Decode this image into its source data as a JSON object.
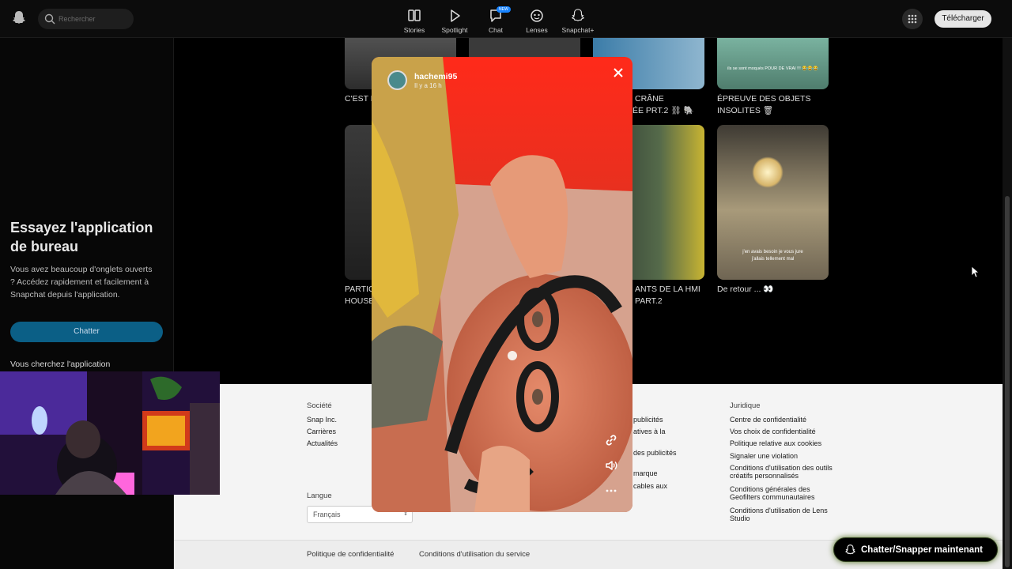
{
  "topbar": {
    "search_placeholder": "Rechercher",
    "nav": [
      {
        "label": "Stories"
      },
      {
        "label": "Spotlight"
      },
      {
        "label": "Chat",
        "badge": "NEW"
      },
      {
        "label": "Lenses"
      },
      {
        "label": "Snapchat+"
      }
    ],
    "download_label": "Télécharger"
  },
  "sidebar": {
    "title": "Essayez l'application de bureau",
    "description": "Vous avez beaucoup d'onglets ouverts ? Accédez rapidement et facilement à Snapchat depuis l'application.",
    "chat_button": "Chatter",
    "looking_for_app": "Vous cherchez l'application"
  },
  "spotlight_tiles": [
    {
      "label_line1": "C'EST F",
      "label_line2": ""
    },
    {
      "label_line1": "CRÂNE",
      "label_line2": "ÉE PRT.2 ⛓ 🐘"
    },
    {
      "label_line1": "ÉPREUVE DES OBJETS",
      "label_line2": "INSOLITES 🗑"
    },
    {
      "label_line1": "PARTIC",
      "label_line2": "HOUSE"
    },
    {
      "label_line1": "ANTS DE LA HMI",
      "label_line2": "PART.2"
    },
    {
      "label_line1": "De retour ... 👀",
      "label_line2": ""
    }
  ],
  "tile_overlay_text": {
    "tile3": "ils se sont moqués POUR DE VRAI !!! 😂😂😂",
    "tile6_line1": "j'en avais besoin je vous jure",
    "tile6_line2": "j'allais tellement mal"
  },
  "viewer": {
    "username": "hachemi95",
    "time": "Il y a 16 h"
  },
  "footer": {
    "col1_title": "Société",
    "col1_items": [
      "Snap Inc.",
      "Carrières",
      "Actualités"
    ],
    "col3_items": [
      "publicités",
      "atives à la",
      "des publicités",
      "marque",
      "cables aux"
    ],
    "col4_title": "Juridique",
    "col4_items": [
      "Centre de confidentialité",
      "Vos choix de confidentialité",
      "Politique relative aux cookies",
      "Signaler une violation",
      "Conditions d'utilisation des outils créatifs personnalisés",
      "Conditions générales des Geofilters communautaires",
      "Conditions d'utilisation de Lens Studio"
    ],
    "language_label": "Langue",
    "language_value": "Français",
    "bottom_links": [
      "Politique de confidentialité",
      "Conditions d'utilisation du service"
    ]
  },
  "cta": {
    "label": "Chatter/Snapper maintenant"
  },
  "colors": {
    "accent_blue": "#0b5f86",
    "snap_yellow": "#fffc00",
    "footer_bg": "#f4f4f4"
  }
}
